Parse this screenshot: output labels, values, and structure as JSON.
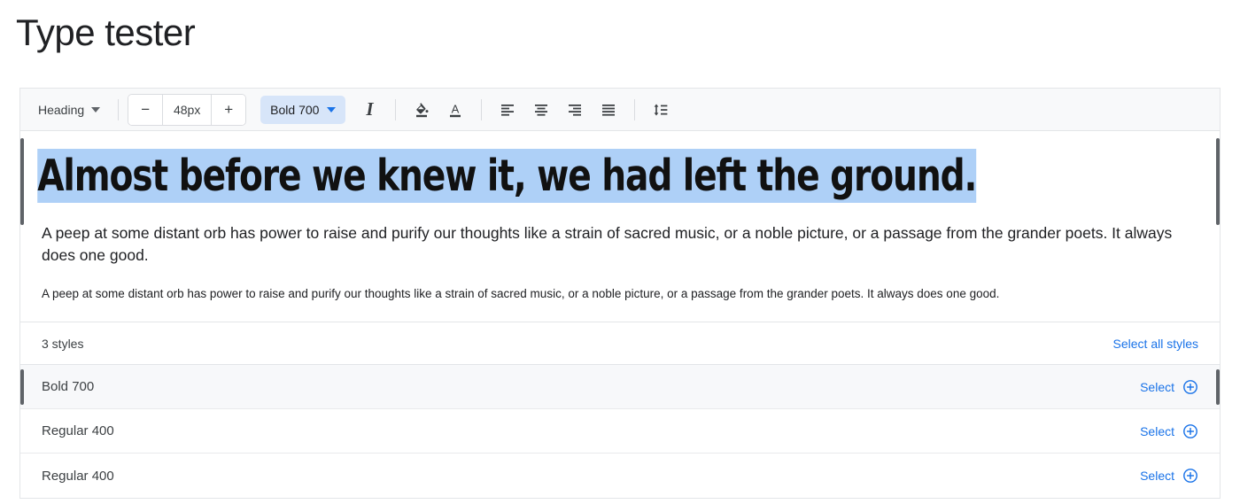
{
  "page": {
    "title": "Type tester"
  },
  "toolbar": {
    "block_style": "Heading",
    "block_style_caret_icon": "chevron-down-icon",
    "size_decrement_label": "−",
    "size_value": "48px",
    "size_increment_label": "+",
    "weight_label": "Bold 700",
    "weight_caret_icon": "chevron-down-icon",
    "accent_color": "#1a73e8",
    "weight_pill_bg": "#d7e5f9",
    "icons": [
      "italic-icon",
      "fill-color-icon",
      "text-color-icon",
      "align-left-icon",
      "align-center-icon",
      "align-right-icon",
      "align-justify-icon",
      "line-height-icon"
    ]
  },
  "preview": {
    "heading": "Almost before we knew it, we had left the ground.",
    "heading_highlight_color": "#aed0f7",
    "paragraph_large": "A peep at some distant orb has power to raise and purify our thoughts like a strain of sacred music, or a noble picture, or a passage from the grander poets. It always does one good.",
    "paragraph_small": "A peep at some distant orb has power to raise and purify our thoughts like a strain of sacred music, or a noble picture, or a passage from the grander poets. It always does one good."
  },
  "styles_section": {
    "count_label": "3 styles",
    "select_all_label": "Select all styles",
    "rows": [
      {
        "name": "Bold 700",
        "select_label": "Select",
        "selected": true
      },
      {
        "name": "Regular 400",
        "select_label": "Select",
        "selected": false
      },
      {
        "name": "Regular 400",
        "select_label": "Select",
        "selected": false
      }
    ]
  }
}
